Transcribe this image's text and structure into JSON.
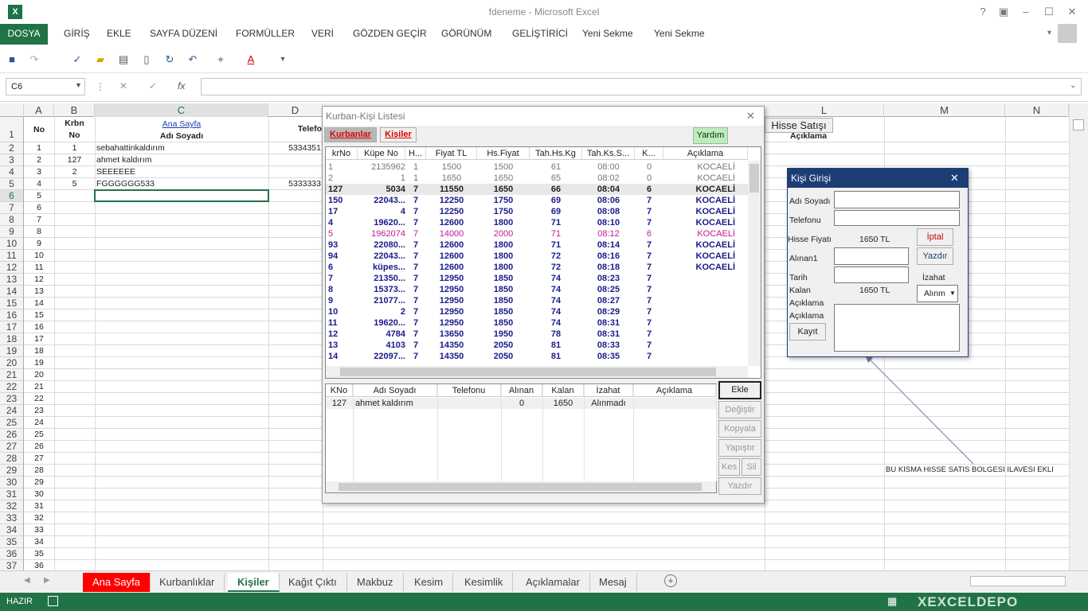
{
  "window": {
    "title": "fdeneme - Microsoft Excel",
    "logo": "X"
  },
  "ribbon": {
    "tabs": [
      "DOSYA",
      "GİRİŞ",
      "EKLE",
      "SAYFA DÜZENİ",
      "FORMÜLLER",
      "VERİ",
      "GÖZDEN GEÇİR",
      "GÖRÜNÜM",
      "GELİŞTİRİCİ",
      "Yeni Sekme",
      "Yeni Sekme"
    ]
  },
  "formula_bar": {
    "name_box": "C6",
    "fx": "fx",
    "value": ""
  },
  "columns": [
    "A",
    "B",
    "C",
    "D",
    "L",
    "M",
    "N"
  ],
  "header_cells": {
    "a": "No",
    "b1": "Krbn",
    "b2": "No",
    "c_link": "Ana Sayfa",
    "c2": "Adı Soyadı",
    "d": "Telefo",
    "l_button": "Hisse Satışı",
    "l2": "Açıklama"
  },
  "rows": [
    {
      "a": "1",
      "b": "1",
      "c": "sebahattinkaldırım",
      "d": "5334351"
    },
    {
      "a": "2",
      "b": "127",
      "c": "ahmet kaldırım",
      "d": ""
    },
    {
      "a": "3",
      "b": "2",
      "c": "SEEEEEE",
      "d": ""
    },
    {
      "a": "4",
      "b": "5",
      "c": "FGGGGGG533",
      "d": "5333333"
    }
  ],
  "row_numbers": [
    "1",
    "2",
    "3",
    "4",
    "5",
    "6",
    "7",
    "8",
    "9",
    "10",
    "11",
    "12",
    "13",
    "14",
    "15",
    "16",
    "17",
    "18",
    "19",
    "20",
    "21",
    "22",
    "23",
    "24",
    "25",
    "26",
    "27",
    "28",
    "29",
    "30",
    "31",
    "32",
    "33",
    "34",
    "35",
    "36",
    "37"
  ],
  "a_values": [
    "5",
    "6",
    "7",
    "8",
    "9",
    "10",
    "11",
    "12",
    "13",
    "14",
    "15",
    "16",
    "17",
    "18",
    "19",
    "20",
    "21",
    "22",
    "23",
    "24",
    "25",
    "26",
    "27",
    "28",
    "29",
    "30",
    "31",
    "32",
    "33",
    "34",
    "35",
    "36"
  ],
  "annotation": "BU KISMA HISSE SATIS BOLGESI ILAVESI EKLI",
  "sheets": [
    "Ana Sayfa",
    "Kurbanlıklar",
    "Kişiler",
    "Kağıt Çıktı",
    "Makbuz",
    "Kesim",
    "Kesimlik",
    "Açıklamalar",
    "Mesaj"
  ],
  "status": {
    "ready": "HAZIR",
    "watermark": "XEXCELDEPO"
  },
  "kurban_dialog": {
    "title": "Kurban-Kişi Listesi",
    "tab_kurbanlar": "Kurbanlar",
    "tab_kisiler": "Kişiler",
    "help": "Yardım",
    "headers": [
      "krNo",
      "Küpe No",
      "H...",
      "Fiyat TL",
      "Hs.Fiyat",
      "Tah.Hs.Kg",
      "Tah.Ks.S...",
      "K...",
      "Açıklama"
    ],
    "rows": [
      [
        "1",
        "2135962",
        "1",
        "1500",
        "1500",
        "61",
        "08:00",
        "0",
        "KOCAELİ"
      ],
      [
        "2",
        "1",
        "1",
        "1650",
        "1650",
        "65",
        "08:02",
        "0",
        "KOCAELİ"
      ],
      [
        "127",
        "5034",
        "7",
        "11550",
        "1650",
        "66",
        "08:04",
        "6",
        "KOCAELİ"
      ],
      [
        "150",
        "22043...",
        "7",
        "12250",
        "1750",
        "69",
        "08:06",
        "7",
        "KOCAELİ"
      ],
      [
        "17",
        "4",
        "7",
        "12250",
        "1750",
        "69",
        "08:08",
        "7",
        "KOCAELİ"
      ],
      [
        "4",
        "19620...",
        "7",
        "12600",
        "1800",
        "71",
        "08:10",
        "7",
        "KOCAELİ"
      ],
      [
        "5",
        "1962074",
        "7",
        "14000",
        "2000",
        "71",
        "08:12",
        "6",
        "KOCAELİ"
      ],
      [
        "93",
        "22080...",
        "7",
        "12600",
        "1800",
        "71",
        "08:14",
        "7",
        "KOCAELİ"
      ],
      [
        "94",
        "22043...",
        "7",
        "12600",
        "1800",
        "72",
        "08:16",
        "7",
        "KOCAELİ"
      ],
      [
        "6",
        "küpes...",
        "7",
        "12600",
        "1800",
        "72",
        "08:18",
        "7",
        "KOCAELİ"
      ],
      [
        "7",
        "21350...",
        "7",
        "12950",
        "1850",
        "74",
        "08:23",
        "7",
        ""
      ],
      [
        "8",
        "15373...",
        "7",
        "12950",
        "1850",
        "74",
        "08:25",
        "7",
        ""
      ],
      [
        "9",
        "21077...",
        "7",
        "12950",
        "1850",
        "74",
        "08:27",
        "7",
        ""
      ],
      [
        "10",
        "2",
        "7",
        "12950",
        "1850",
        "74",
        "08:29",
        "7",
        ""
      ],
      [
        "11",
        "19620...",
        "7",
        "12950",
        "1850",
        "74",
        "08:31",
        "7",
        ""
      ],
      [
        "12",
        "4784",
        "7",
        "13650",
        "1950",
        "78",
        "08:31",
        "7",
        ""
      ],
      [
        "13",
        "4103",
        "7",
        "14350",
        "2050",
        "81",
        "08:33",
        "7",
        ""
      ],
      [
        "14",
        "22097...",
        "7",
        "14350",
        "2050",
        "81",
        "08:35",
        "7",
        ""
      ]
    ],
    "row_styles": [
      "grey",
      "grey",
      "black",
      "navy",
      "navy",
      "navy",
      "magenta",
      "navy",
      "navy",
      "navy",
      "navy",
      "navy",
      "navy",
      "navy",
      "navy",
      "navy",
      "navy",
      "navy"
    ],
    "sub_headers": [
      "KNo",
      "Adı Soyadı",
      "Telefonu",
      "Alınan",
      "Kalan",
      "İzahat",
      "Açıklama"
    ],
    "sub_rows": [
      [
        "127",
        "ahmet kaldırım",
        "",
        "0",
        "1650",
        "Alınmadı",
        ""
      ]
    ],
    "buttons": [
      "Ekle",
      "Değiştir",
      "Kopyala",
      "Yapıştır",
      "Kes",
      "Sil",
      "Yazdır"
    ]
  },
  "kisi_dialog": {
    "title": "Kişi Girişi",
    "close": "✕",
    "labels": {
      "adi": "Adı Soyadı",
      "tel": "Telefonu",
      "hisse": "Hisse Fiyatı",
      "alinan": "Alınan1",
      "tarih": "Tarih",
      "kalan": "Kalan",
      "aciklama1": "Açıklama",
      "aciklama2": "Açıklama",
      "izahat": "İzahat"
    },
    "hisse_value": "1650 TL",
    "kalan_value": "1650 TL",
    "select_value": "Alınm",
    "buttons": {
      "iptal": "İptal",
      "yazdir": "Yazdır",
      "kayit": "Kayıt"
    }
  }
}
